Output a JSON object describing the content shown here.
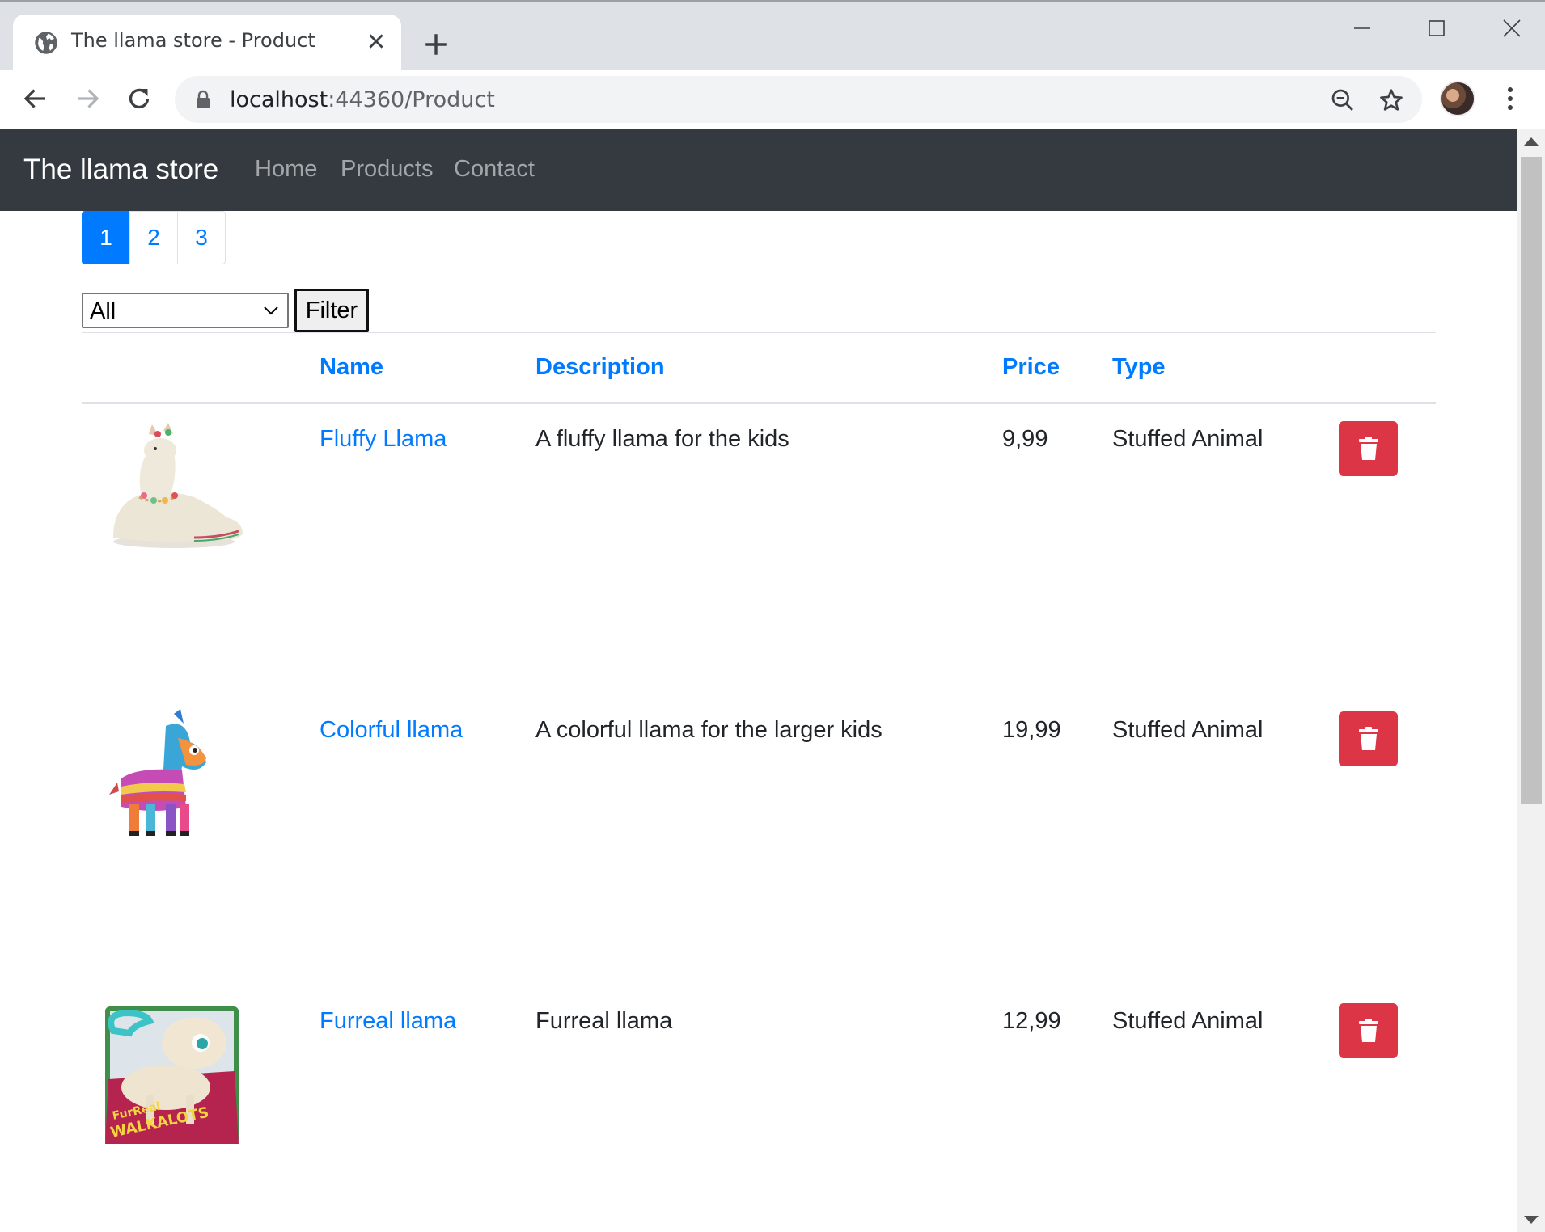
{
  "browser": {
    "tab_title": "The llama store - Product",
    "url_host": "localhost",
    "url_path": ":44360/Product"
  },
  "site": {
    "brand": "The llama store",
    "nav": [
      "Home",
      "Products",
      "Contact"
    ]
  },
  "pagination": {
    "pages": [
      "1",
      "2",
      "3"
    ],
    "active": "1"
  },
  "filter": {
    "selected": "All",
    "button_label": "Filter"
  },
  "table": {
    "headers": {
      "name": "Name",
      "description": "Description",
      "price": "Price",
      "type": "Type"
    },
    "rows": [
      {
        "name": "Fluffy Llama",
        "description": "A fluffy llama for the kids",
        "price": "9,99",
        "type": "Stuffed Animal",
        "image": "fluffy-llama-plush"
      },
      {
        "name": "Colorful llama",
        "description": "A colorful llama for the larger kids",
        "price": "19,99",
        "type": "Stuffed Animal",
        "image": "pinata-llama"
      },
      {
        "name": "Furreal llama",
        "description": "Furreal llama",
        "price": "12,99",
        "type": "Stuffed Animal",
        "image": "furreal-llama-box"
      }
    ]
  },
  "colors": {
    "navbar_bg": "#343a40",
    "link_blue": "#007bff",
    "danger_red": "#dc3545"
  }
}
